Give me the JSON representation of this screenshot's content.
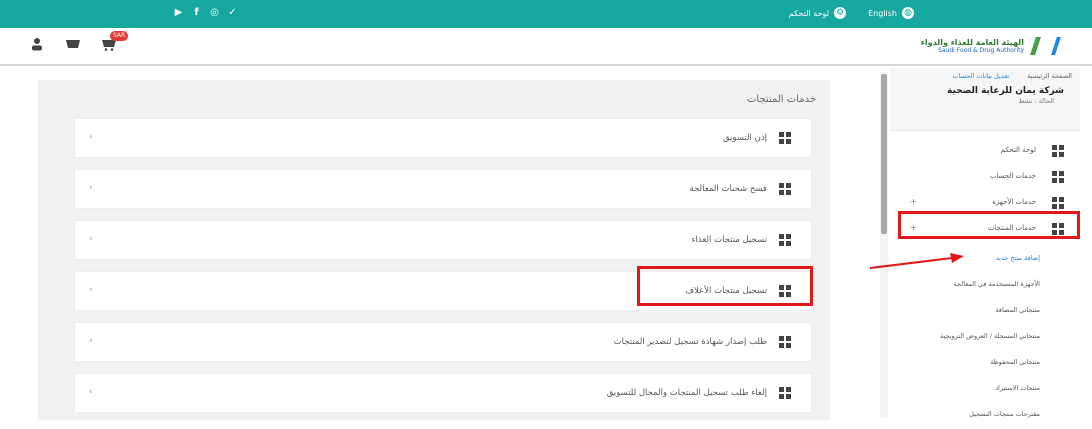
{
  "topbar": {
    "social_icons": [
      "youtube-icon",
      "facebook-icon",
      "instagram-icon",
      "twitter-icon"
    ],
    "social_glyphs": [
      "▶",
      "f",
      "◎",
      "✓"
    ],
    "settings_label": "لوحة التحكم",
    "language_label": "English",
    "bg_color": "#16a79f"
  },
  "header": {
    "cart_badge": "SAR",
    "logo_ar": "الهيئة العامة للغذاء والدواء",
    "logo_en": "Saudi Food & Drug Authority"
  },
  "sidebar": {
    "breadcrumb_home": "الصفحة الرئيسية",
    "breadcrumb_link": "تعديل بيانات الحساب",
    "company_name": "شركة يمان للرعاية الصحية",
    "company_sub": "الحالة : نشط",
    "menu": [
      {
        "label": "لوحة التحكم",
        "caret": ""
      },
      {
        "label": "خدمات الحساب",
        "caret": ""
      },
      {
        "label": "خدمات الأجهزة",
        "caret": "+"
      },
      {
        "label": "خدمات المنتجات",
        "caret": "+"
      }
    ],
    "submenu": [
      "إضافة منتج جديد",
      "الأجهزة المستخدمة في المعالجة",
      "منتجاتي المضافة",
      "منتجاتي المسجلة / العروض الترويجية",
      "منتجاتي المحفوظة",
      "منتجات الاستيراد",
      "مقترحات منتجات التسجيل"
    ]
  },
  "main": {
    "title": "خدمات المنتجات",
    "rows": [
      "إذن التسويق",
      "فسح شحنات المعالجة",
      "تسجيل منتجات الغذاء",
      "تسجيل منتجات الأعلاف",
      "طلب إصدار شهادة تسجيل لتصدير المنتجات",
      "إلغاء طلب تسجيل المنتجات والمحال للتسويق"
    ],
    "chevron": "‹"
  },
  "colors": {
    "accent": "#16a79f",
    "highlight": "#e0181b",
    "link": "#1e88e5"
  }
}
